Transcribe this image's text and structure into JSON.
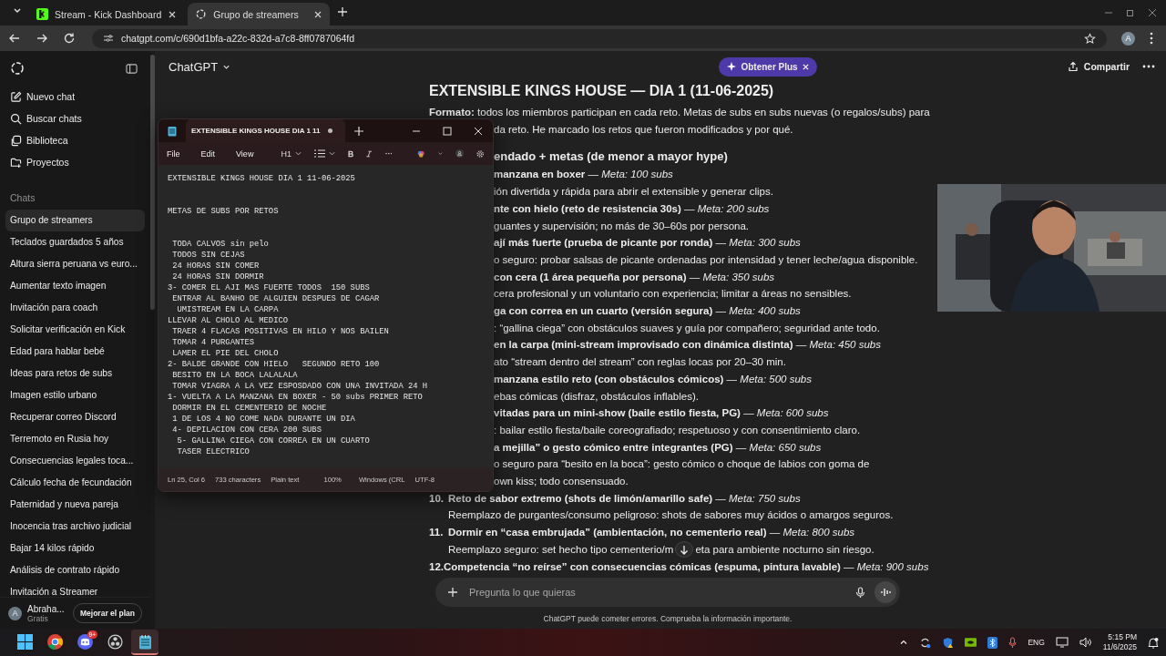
{
  "browser": {
    "tabs": [
      {
        "label": "Stream - Kick Dashboard",
        "kind": "kick",
        "selected": false
      },
      {
        "label": "Grupo de streamers",
        "kind": "chatgpt",
        "selected": true
      }
    ],
    "address": "chatgpt.com/c/690d1bfa-a22c-832d-a7c8-8ff0787064fd",
    "profile_initial": "A"
  },
  "sidebar": {
    "menu": [
      {
        "label": "Nuevo chat",
        "kind": "new"
      },
      {
        "label": "Buscar chats",
        "kind": "search"
      },
      {
        "label": "Biblioteca",
        "kind": "library"
      },
      {
        "label": "Proyectos",
        "kind": "projects"
      }
    ],
    "section_title": "Chats",
    "chats": [
      {
        "label": "Grupo de streamers",
        "selected": true
      },
      {
        "label": "Teclados guardados 5 años",
        "selected": false
      },
      {
        "label": "Altura sierra peruana vs euro...",
        "selected": false
      },
      {
        "label": "Aumentar texto imagen",
        "selected": false
      },
      {
        "label": "Invitación para coach",
        "selected": false
      },
      {
        "label": "Solicitar verificación en Kick",
        "selected": false
      },
      {
        "label": "Edad para hablar bebé",
        "selected": false
      },
      {
        "label": "Ideas para retos de subs",
        "selected": false
      },
      {
        "label": "Imagen estilo urbano",
        "selected": false
      },
      {
        "label": "Recuperar correo Discord",
        "selected": false
      },
      {
        "label": "Terremoto en Rusia hoy",
        "selected": false
      },
      {
        "label": "Consecuencias legales toca...",
        "selected": false
      },
      {
        "label": "Cálculo fecha de fecundación",
        "selected": false
      },
      {
        "label": "Paternidad y nueva pareja",
        "selected": false
      },
      {
        "label": "Inocencia tras archivo judicial",
        "selected": false
      },
      {
        "label": "Bajar 14 kilos rápido",
        "selected": false
      },
      {
        "label": "Análisis de contrato rápido",
        "selected": false
      },
      {
        "label": "Invitación a Streamer",
        "selected": false
      }
    ],
    "user": {
      "initial": "A",
      "name": "Abraha...",
      "plan": "Gratis"
    },
    "upgrade_button": "Mejorar el plan"
  },
  "header": {
    "title": "ChatGPT",
    "promo": "Obtener Plus",
    "share": "Compartir"
  },
  "conversation": {
    "lines": [
      {
        "kind": "title",
        "text": "EXTENSIBLE KINGS HOUSE — DIA 1 (11-06-2025)"
      },
      {
        "kind": "para",
        "text": "**Formato:** todos los miembros participan en cada reto. Metas de subs en subs nuevas (o regalos/subs) para"
      },
      {
        "kind": "frag",
        "text": "da reto. He marcado los retos que fueron modificados y por qué."
      },
      {
        "kind": "heading",
        "text": "endado + metas (de menor a mayor hype)"
      },
      {
        "kind": "frag",
        "text": "**manzana en boxer** — *Meta: 100 subs*"
      },
      {
        "kind": "frag",
        "text": "ión divertida y rápida para abrir el extensible y generar clips."
      },
      {
        "kind": "frag",
        "text": "**nte con hielo (reto de resistencia 30s)** — *Meta: 200 subs*"
      },
      {
        "kind": "frag",
        "text": "guantes y supervisión; no más de 30–60s por persona."
      },
      {
        "kind": "frag",
        "text": "**ají más fuerte (prueba de picante por ronda)** — *Meta: 300 subs*"
      },
      {
        "kind": "frag",
        "text": "o seguro: probar salsas de picante ordenadas por intensidad y tener leche/agua disponible."
      },
      {
        "kind": "frag",
        "text": "**con cera (1 área pequeña por persona)** — *Meta: 350 subs*"
      },
      {
        "kind": "frag",
        "text": "cera profesional y un voluntario con experiencia; limitar a áreas no sensibles."
      },
      {
        "kind": "frag",
        "text": "**ga con correa en un cuarto (versión segura)** — *Meta: 400 subs*"
      },
      {
        "kind": "frag",
        "text": ": “gallina ciega” con obstáculos suaves y guía por compañero; seguridad ante todo."
      },
      {
        "kind": "frag",
        "text": "**en la carpa (mini-stream improvisado con dinámica distinta)** — *Meta: 450 subs*"
      },
      {
        "kind": "frag",
        "text": "ato “stream dentro del stream” con reglas locas por 20–30 min."
      },
      {
        "kind": "frag",
        "text": "**manzana estilo reto (con obstáculos cómicos)** — *Meta: 500 subs*"
      },
      {
        "kind": "frag",
        "text": "ebas cómicas (disfraz, obstáculos inflables)."
      },
      {
        "kind": "frag",
        "text": "**vitadas para un mini-show (baile estilo fiesta, PG)** — *Meta: 600 subs*"
      },
      {
        "kind": "frag",
        "text": ": bailar estilo fiesta/baile coreografiado; respetuoso y con consentimiento claro."
      },
      {
        "kind": "frag",
        "text": "**a mejilla” o gesto cómico entre integrantes (PG)** — *Meta: 650 subs*"
      },
      {
        "kind": "frag",
        "text": "o seguro para “besito en la boca”: gesto cómico o choque de labios con goma de"
      },
      {
        "kind": "frag",
        "text": "own kiss; todo consensuado."
      },
      {
        "kind": "item",
        "number": "10.",
        "text": "**Reto de sabor extremo (shots de limón/amarillo safe)** — *Meta: 750 subs*"
      },
      {
        "kind": "cont",
        "text": "Reemplazo de purgantes/consumo peligroso: shots de sabores muy ácidos o amargos seguros."
      },
      {
        "kind": "item",
        "number": "11.",
        "text": "**Dormir en “casa embrujada” (ambientación, no cementerio real)** — *Meta: 800 subs*"
      },
      {
        "kind": "split",
        "text": "Reemplazo seguro: set hecho tipo cementerio/m",
        "text_after": "eta para ambiente nocturno sin riesgo."
      },
      {
        "kind": "item",
        "number": "12.",
        "text": "**Competencia “no reírse” con consecuencias cómicas (espuma, pintura lavable)** — *Meta: 900 subs*"
      }
    ]
  },
  "composer": {
    "placeholder": "Pregunta lo que quieras"
  },
  "disclaimer": "ChatGPT puede cometer errores. Comprueba la información importante.",
  "notepad": {
    "tab_title": "EXTENSIBLE KINGS HOUSE DIA 1 11",
    "unsaved": true,
    "menus": [
      "File",
      "Edit",
      "View"
    ],
    "heading_control": "H1",
    "text": "EXTENSIBLE KINGS HOUSE DIA 1 11-06-2025\n\n\nMETAS DE SUBS POR RETOS\n\n\n TODA CALVOS sin pelo\n TODOS SIN CEJAS\n 24 HORAS SIN COMER\n 24 HORAS SIN DORMIR\n3- COMER EL AJI MAS FUERTE TODOS  150 SUBS\n ENTRAR AL BANHO DE ALGUIEN DESPUES DE CAGAR\n  UMISTREAM EN LA CARPA\nLLEVAR AL CHOLO AL MEDICO\n TRAER 4 FLACAS POSITIVAS EN HILO Y NOS BAILEN\n TOMAR 4 PURGANTES\n LAMER EL PIE DEL CHOLO\n2- BALDE GRANDE CON HIELO   SEGUNDO RETO 100\n BESITO EN LA BOCA LALALALA\n TOMAR VIAGRA A LA VEZ ESPOSDADO CON UNA INVITADA 24 H\n1- VUELTA A LA MANZANA EN BOXER - 50 subs PRIMER RETO\n DORMIR EN EL CEMENTERIO DE NOCHE\n 1 DE LOS 4 NO COME NADA DURANTE UN DIA\n 4- DEPILACION CON CERA 200 SUBS\n  5- GALLINA CIEGA CON CORREA EN UN CUARTO\n  TASER ELECTRICO",
    "status": [
      "Ln 25, Col 6",
      "733 characters",
      "Plain text",
      "100%",
      "Windows (CRL",
      "UTF-8"
    ]
  },
  "taskbar": {
    "apps": [
      {
        "kind": "windows",
        "active": false
      },
      {
        "kind": "chrome",
        "active": false
      },
      {
        "kind": "discord",
        "badge": "9+",
        "active": false
      },
      {
        "kind": "obs",
        "active": false
      },
      {
        "kind": "notepad",
        "active": true
      }
    ],
    "language": "ENG",
    "time": "5:15 PM",
    "date": "11/6/2025"
  }
}
